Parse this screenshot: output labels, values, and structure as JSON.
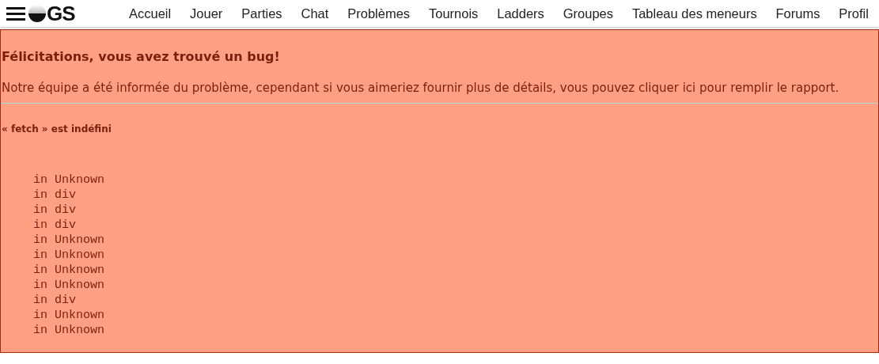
{
  "nav": {
    "logo_text": "GS",
    "items": [
      "Accueil",
      "Jouer",
      "Parties",
      "Chat",
      "Problèmes",
      "Tournois",
      "Ladders",
      "Groupes",
      "Tableau des meneurs",
      "Forums",
      "Profil"
    ]
  },
  "error": {
    "title": "Félicitations, vous avez trouvé un bug!",
    "message": "Notre équipe a été informée du problème, cependant si vous aimeriez fournir plus de détails, vous pouvez cliquer ici pour remplir le rapport.",
    "exception": "« fetch » est indéfini",
    "stack": [
      "in Unknown",
      "in div",
      "in div",
      "in div",
      "in Unknown",
      "in Unknown",
      "in Unknown",
      "in Unknown",
      "in div",
      "in Unknown",
      "in Unknown"
    ]
  }
}
